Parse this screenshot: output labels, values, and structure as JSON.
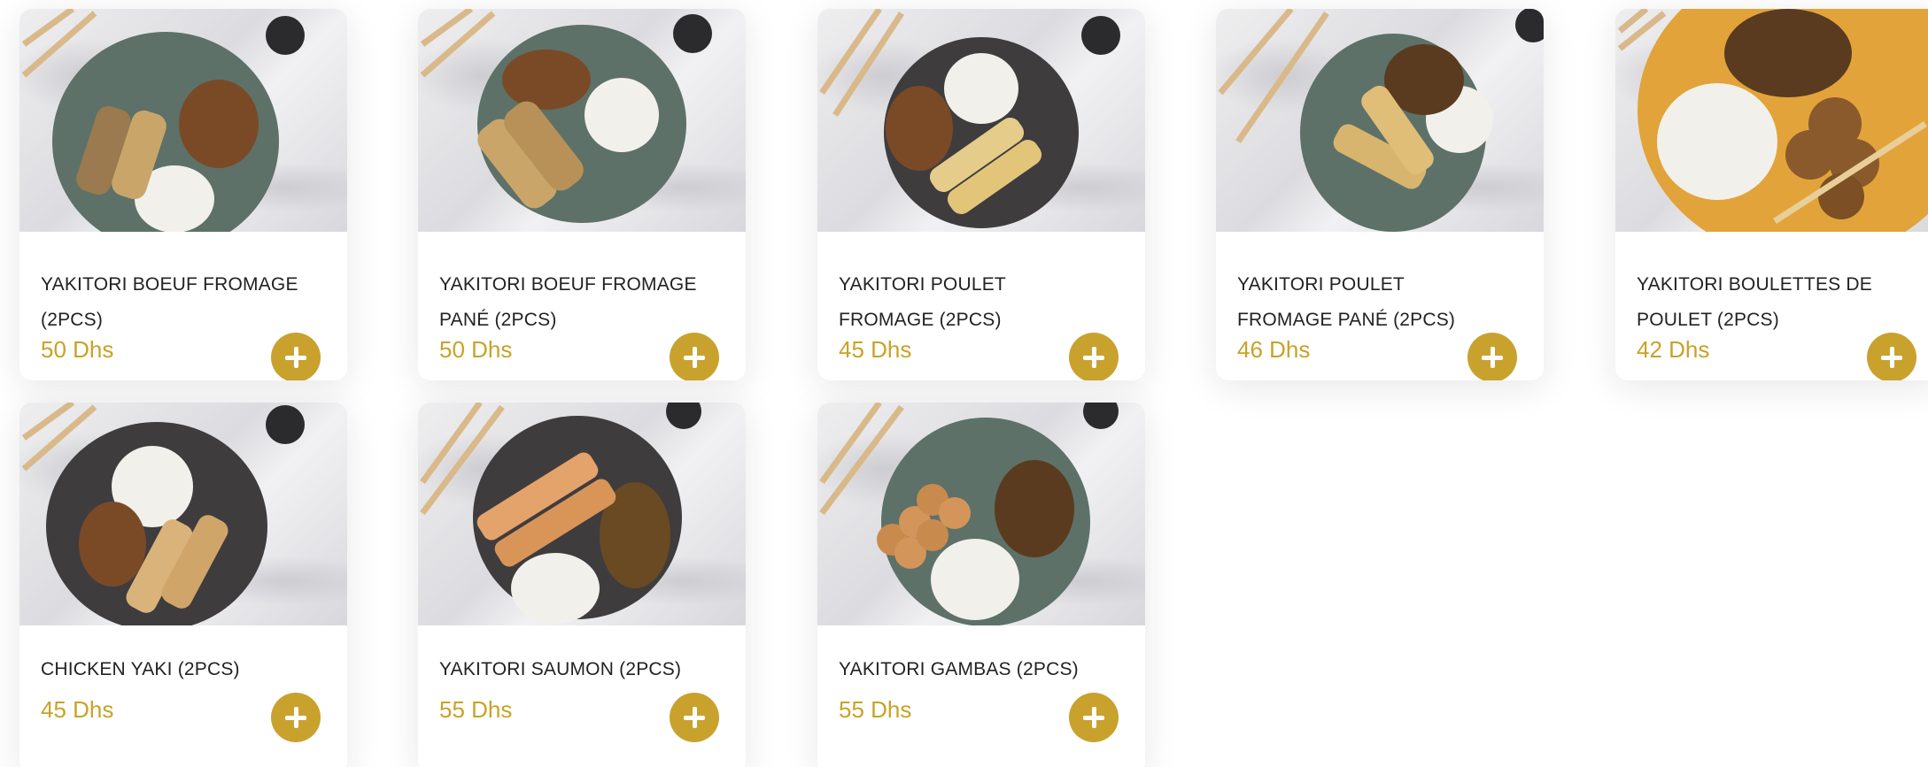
{
  "products": [
    {
      "name": "YAKITORI BOEUF FROMAGE (2PCS)",
      "price": "50 Dhs",
      "plate_color": "#5d7168",
      "add_icon": "plus-icon"
    },
    {
      "name": "YAKITORI BOEUF FROMAGE PANÉ (2PCS)",
      "price": "50 Dhs",
      "plate_color": "#5d7168",
      "add_icon": "plus-icon"
    },
    {
      "name": "YAKITORI POULET FROMAGE (2PCS)",
      "price": "45 Dhs",
      "plate_color": "#3f3c3e",
      "add_icon": "plus-icon"
    },
    {
      "name": "YAKITORI POULET FROMAGE PANÉ (2PCS)",
      "price": "46 Dhs",
      "plate_color": "#5d7168",
      "add_icon": "plus-icon"
    },
    {
      "name": "YAKITORI BOULETTES DE POULET (2PCS)",
      "price": "42 Dhs",
      "plate_color": "#e2a33a",
      "add_icon": "plus-icon"
    },
    {
      "name": "CHICKEN YAKI (2PCS)",
      "price": "45 Dhs",
      "plate_color": "#3f3c3e",
      "add_icon": "plus-icon"
    },
    {
      "name": "YAKITORI SAUMON (2PCS)",
      "price": "55 Dhs",
      "plate_color": "#3f3c3e",
      "add_icon": "plus-icon"
    },
    {
      "name": "YAKITORI GAMBAS (2PCS)",
      "price": "55 Dhs",
      "plate_color": "#5d7168",
      "add_icon": "plus-icon"
    }
  ],
  "colors": {
    "accent": "#c9a22e",
    "price": "#c9a227",
    "text": "#222222"
  }
}
